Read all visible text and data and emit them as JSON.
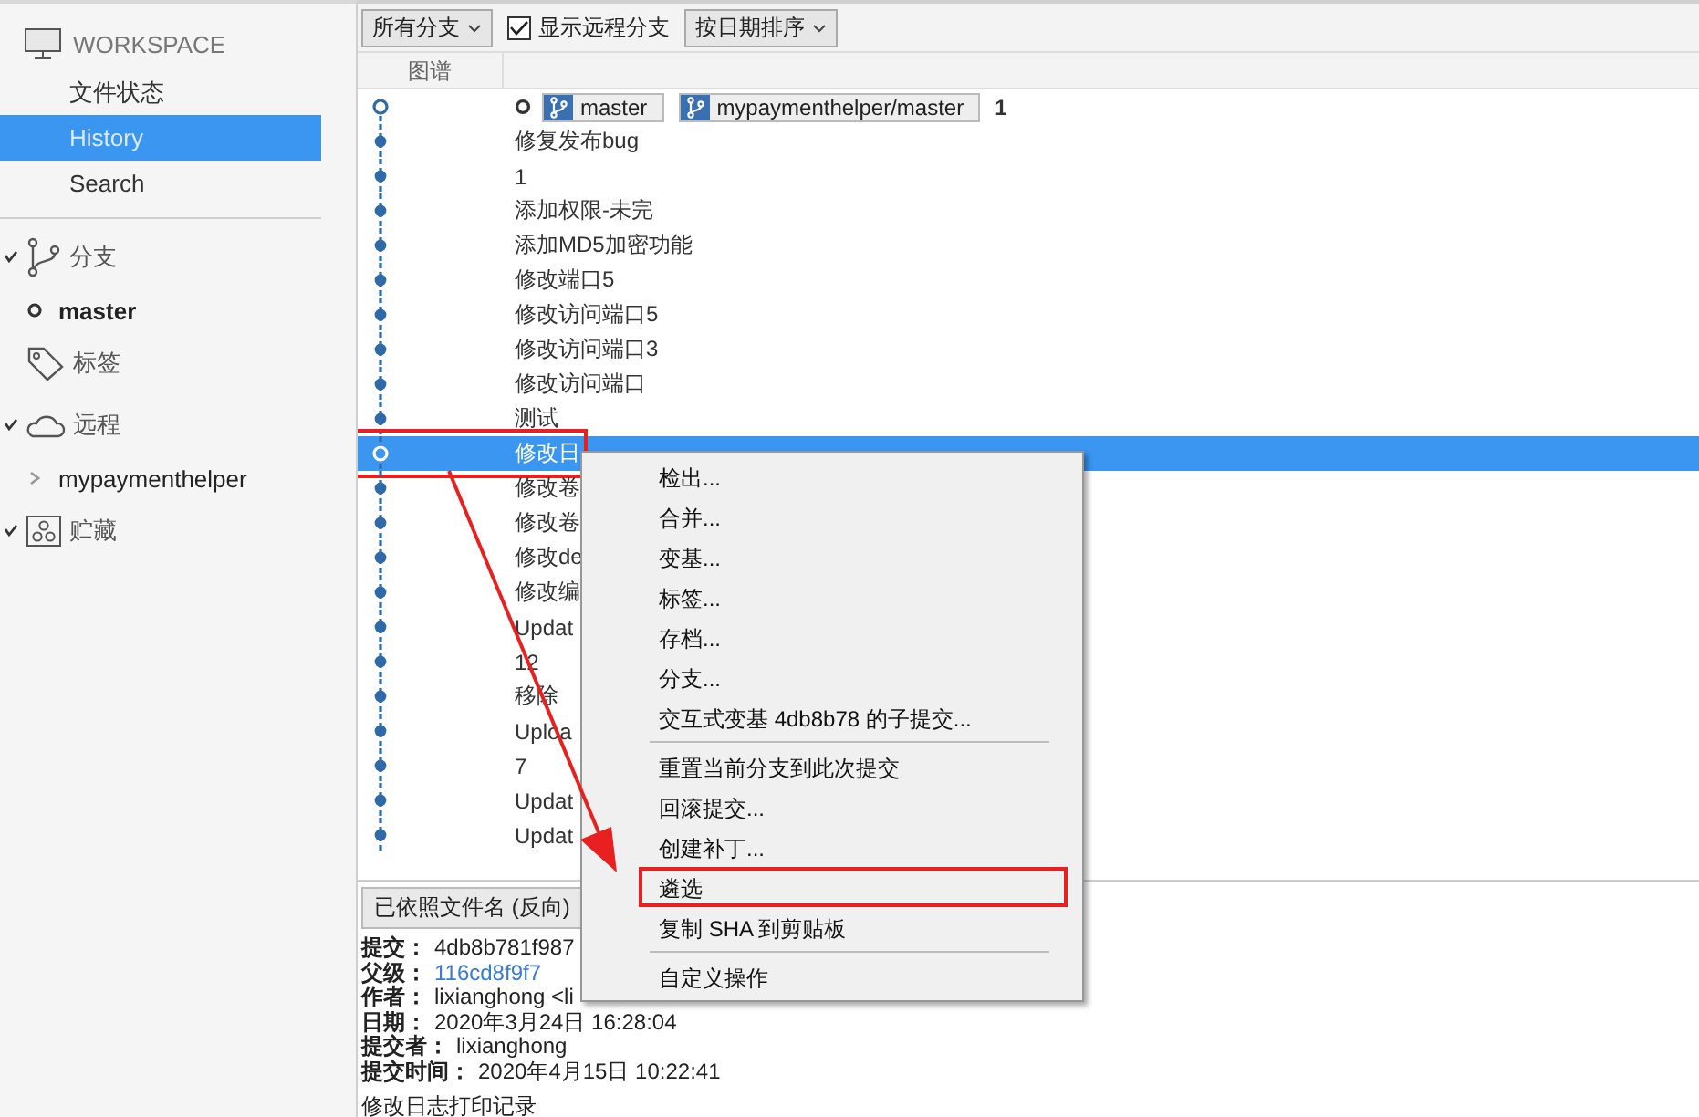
{
  "sidebar": {
    "workspace": {
      "title": "WORKSPACE",
      "items": [
        {
          "label": "文件状态",
          "selected": false
        },
        {
          "label": "History",
          "selected": true
        },
        {
          "label": "Search",
          "selected": false
        }
      ]
    },
    "sections": [
      {
        "kind": "branches",
        "label": "分支",
        "expanded": true,
        "children": [
          {
            "kind": "current",
            "label": "master"
          }
        ]
      },
      {
        "kind": "tags",
        "label": "标签",
        "expanded": false
      },
      {
        "kind": "remotes",
        "label": "远程",
        "expanded": true,
        "children": [
          {
            "kind": "remote",
            "label": "mypaymenthelper"
          }
        ]
      },
      {
        "kind": "stashes",
        "label": "贮藏",
        "expanded": true
      }
    ]
  },
  "toolbar": {
    "branch_filter": "所有分支",
    "show_remote": {
      "label": "显示远程分支",
      "checked": true
    },
    "sort": "按日期排序"
  },
  "columns": [
    "图谱"
  ],
  "commits": [
    {
      "message": "1",
      "head": true,
      "refs": [
        "master",
        "mypaymenthelper/master"
      ],
      "selected": false,
      "highlighted": false
    },
    {
      "message": "修复发布bug",
      "head": false,
      "selected": false,
      "highlighted": false
    },
    {
      "message": "1",
      "head": false,
      "selected": false,
      "highlighted": false
    },
    {
      "message": "添加权限-未完",
      "head": false,
      "selected": false,
      "highlighted": false
    },
    {
      "message": "添加MD5加密功能",
      "head": false,
      "selected": false,
      "highlighted": false
    },
    {
      "message": "修改端口5",
      "head": false,
      "selected": false,
      "highlighted": false
    },
    {
      "message": "修改访问端口5",
      "head": false,
      "selected": false,
      "highlighted": false
    },
    {
      "message": "修改访问端口3",
      "head": false,
      "selected": false,
      "highlighted": false
    },
    {
      "message": "修改访问端口",
      "head": false,
      "selected": false,
      "highlighted": false
    },
    {
      "message": "测试",
      "head": false,
      "selected": false,
      "highlighted": false
    },
    {
      "message": "修改日",
      "head": false,
      "selected": true,
      "highlighted": true
    },
    {
      "message": "修改卷",
      "head": false,
      "selected": false,
      "highlighted": false
    },
    {
      "message": "修改卷",
      "head": false,
      "selected": false,
      "highlighted": false
    },
    {
      "message": "修改de",
      "head": false,
      "selected": false,
      "highlighted": false
    },
    {
      "message": "修改编",
      "head": false,
      "selected": false,
      "highlighted": false
    },
    {
      "message": "Updat",
      "head": false,
      "selected": false,
      "highlighted": false
    },
    {
      "message": "12",
      "head": false,
      "selected": false,
      "highlighted": false
    },
    {
      "message": "移除",
      "head": false,
      "selected": false,
      "highlighted": false
    },
    {
      "message": "Uploa",
      "head": false,
      "selected": false,
      "highlighted": false
    },
    {
      "message": "7",
      "head": false,
      "selected": false,
      "highlighted": false
    },
    {
      "message": "Updat",
      "head": false,
      "selected": false,
      "highlighted": false
    },
    {
      "message": "Updat",
      "head": false,
      "selected": false,
      "highlighted": false
    }
  ],
  "details": {
    "sort_button": "已依照文件名 (反向)",
    "fields": [
      {
        "label": "提交：",
        "value": "4db8b781f987",
        "kind": "text"
      },
      {
        "label": "父级：",
        "value": "116cd8f9f7",
        "kind": "link"
      },
      {
        "label": "作者：",
        "value": "lixianghong <li",
        "kind": "text"
      },
      {
        "label": "日期：",
        "value": "2020年3月24日 16:28:04",
        "kind": "text"
      },
      {
        "label": "提交者：",
        "value": "lixianghong",
        "kind": "text"
      },
      {
        "label": "提交时间：",
        "value": "2020年4月15日 10:22:41",
        "kind": "text"
      }
    ],
    "message": "修改日志打印记录"
  },
  "context_menu": {
    "items": [
      {
        "kind": "item",
        "label": "检出...",
        "highlighted": false
      },
      {
        "kind": "item",
        "label": "合并...",
        "highlighted": false
      },
      {
        "kind": "item",
        "label": "变基...",
        "highlighted": false
      },
      {
        "kind": "item",
        "label": "标签...",
        "highlighted": false
      },
      {
        "kind": "item",
        "label": "存档...",
        "highlighted": false
      },
      {
        "kind": "item",
        "label": "分支...",
        "highlighted": false
      },
      {
        "kind": "item",
        "label": "交互式变基 4db8b78 的子提交...",
        "highlighted": false
      },
      {
        "kind": "separator"
      },
      {
        "kind": "item",
        "label": "重置当前分支到此次提交",
        "highlighted": false
      },
      {
        "kind": "item",
        "label": "回滚提交...",
        "highlighted": false
      },
      {
        "kind": "item",
        "label": "创建补丁...",
        "highlighted": false
      },
      {
        "kind": "item",
        "label": "遴选",
        "highlighted": true
      },
      {
        "kind": "item",
        "label": "复制 SHA 到剪贴板",
        "highlighted": false
      },
      {
        "kind": "separator"
      },
      {
        "kind": "item",
        "label": "自定义操作",
        "highlighted": false
      }
    ]
  },
  "annotation_arrow": true
}
